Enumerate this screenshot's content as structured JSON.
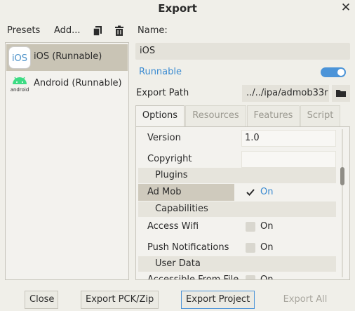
{
  "window": {
    "title": "Export",
    "close_glyph": "✕"
  },
  "presets_toolbar": {
    "presets_label": "Presets",
    "add_label": "Add...",
    "icons": [
      "duplicate-icon",
      "trash-icon"
    ]
  },
  "presets": [
    {
      "label": "iOS (Runnable)",
      "icon": "ios-icon",
      "icon_text": "iOS",
      "selected": true
    },
    {
      "label": "Android (Runnable)",
      "icon": "android-icon",
      "icon_text": "android",
      "selected": false
    }
  ],
  "fields": {
    "name_label": "Name:",
    "name_value": "iOS",
    "runnable_label": "Runnable",
    "runnable_on": true,
    "export_path_label": "Export Path",
    "export_path_value": "../../ipa/admob33r"
  },
  "tabs": [
    {
      "label": "Options",
      "active": true
    },
    {
      "label": "Resources",
      "active": false
    },
    {
      "label": "Features",
      "active": false
    },
    {
      "label": "Script",
      "active": false
    }
  ],
  "options": {
    "version_label": "Version",
    "version_value": "1.0",
    "copyright_label": "Copyright",
    "copyright_value": "",
    "plugins_section": "Plugins",
    "admob_label": "Ad Mob",
    "admob_value": "On",
    "admob_checked": true,
    "capabilities_section": "Capabilities",
    "access_wifi_label": "Access Wifi",
    "access_wifi_value": "On",
    "access_wifi_checked": false,
    "push_label": "Push Notifications",
    "push_value": "On",
    "push_checked": false,
    "user_data_section": "User Data",
    "accessible_label": "Accessible From File",
    "accessible_value": "On",
    "accessible_checked": false,
    "scroll_position": 0.29
  },
  "buttons": {
    "close": "Close",
    "export_pck": "Export PCK/Zip",
    "export_project": "Export Project",
    "export_all": "Export All"
  },
  "colors": {
    "accent": "#4c94d8",
    "selected_bg": "#c9c4b5",
    "dialog_bg": "#f0efe9",
    "android_green": "#3ddc84"
  }
}
